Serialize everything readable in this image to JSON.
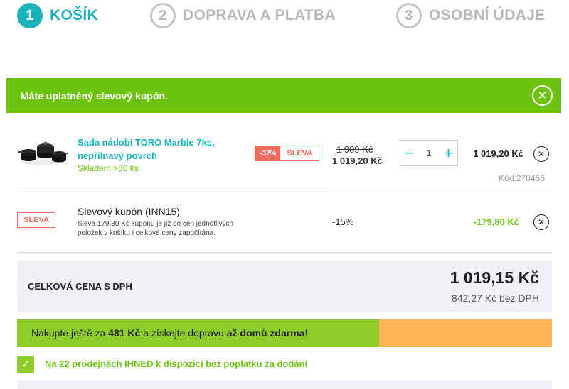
{
  "steps": [
    {
      "num": "1",
      "label": "KOŠÍK"
    },
    {
      "num": "2",
      "label": "DOPRAVA A PLATBA"
    },
    {
      "num": "3",
      "label": "OSOBNÍ ÚDAJE"
    }
  ],
  "alert": {
    "text": "Máte uplatněný slevový kupón.",
    "close_icon": "✕"
  },
  "product": {
    "name": "Sada nádobí TORO Marble 7ks, nepřilnavý povrch",
    "stock": "Skladem >50 ks",
    "discount_pct": "-32%",
    "discount_label": "SLEVA",
    "price_old": "1 909 Kč",
    "price_new": "1 019,20 Kč",
    "quantity": "1",
    "qty_minus": "−",
    "qty_plus": "+",
    "total": "1 019,20 Kč",
    "code": "Kód:270456",
    "remove_icon": "✕"
  },
  "coupon": {
    "badge": "SLEVA",
    "title": "Slevový kupón (INN15)",
    "description": "Sleva 179,80 Kč kuponu je již do cen jednotlivých položek v košíku i celkové ceny započítána.",
    "percent": "-15%",
    "amount": "-179,80 Kč",
    "remove_icon": "✕"
  },
  "total": {
    "label": "CELKOVÁ CENA S DPH",
    "price": "1 019,15 Kč",
    "net": "842,27 Kč bez DPH"
  },
  "shipping": {
    "text_1": "Nakupte ještě za ",
    "amount": "481 Kč",
    "text_2": " a získejte dopravu ",
    "highlight": "až domů zdarma",
    "text_3": "!",
    "progress": 0.677
  },
  "pickup": {
    "check_icon": "✓",
    "text": "Na 22 prodejnách IHNED k dispozici bez poplatku za dodání"
  },
  "colors": {
    "accent": "#1bb2b9",
    "green": "#6cc20e",
    "sale": "#f26b5b",
    "orange": "#fdb553"
  }
}
